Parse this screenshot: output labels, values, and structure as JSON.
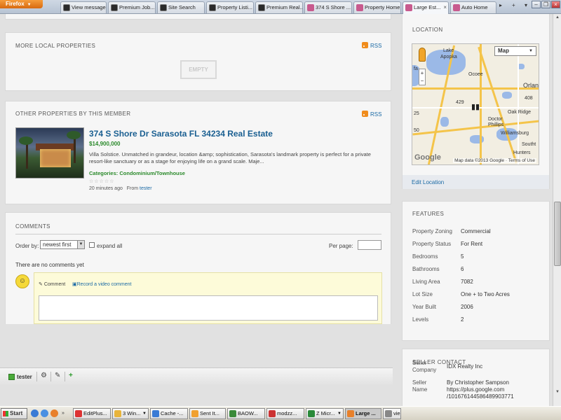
{
  "browser": {
    "firefox_button": "Firefox",
    "tabs": [
      {
        "label": "View message",
        "fav": "dark"
      },
      {
        "label": "Premium Job...",
        "fav": "dark"
      },
      {
        "label": "Site Search",
        "fav": "dark"
      },
      {
        "label": "Property Listi...",
        "fav": "dark"
      },
      {
        "label": "Premium Real...",
        "fav": "dark"
      },
      {
        "label": "374 S Shore ...",
        "fav": "pink"
      },
      {
        "label": "Property Home",
        "fav": "pink"
      },
      {
        "label": "Large Est...",
        "fav": "pink",
        "active": true
      },
      {
        "label": "Auto Home",
        "fav": "pink"
      }
    ]
  },
  "more_local": {
    "title": "MORE LOCAL PROPERTIES",
    "rss": "RSS",
    "empty_label": "EMPTY"
  },
  "other_props": {
    "title": "OTHER PROPERTIES BY THIS MEMBER",
    "rss": "RSS",
    "listing": {
      "title": "374 S Shore Dr Sarasota FL 34234 Real Estate",
      "price": "$14,900,000",
      "description": "Villa Solstice. Unmatched in grandeur, location &amp; sophistication, Sarasota's landmark property is perfect for a private resort-like sanctuary or as a stage for enjoying life on a grand scale. Maje...",
      "categories_label": "Categories:",
      "category": "Condominium/Townhouse",
      "stars": "☆☆☆☆☆",
      "posted": "20 minutes ago",
      "from_label": "From",
      "author": "tester"
    }
  },
  "comments": {
    "title": "COMMENTS",
    "order_by_label": "Order by:",
    "order_by_value": "newest first",
    "expand_all_label": "expand all",
    "per_page_label": "Per page:",
    "no_comments": "There are no comments yet",
    "comment_tab": "Comment",
    "video_tab": "Record a video comment"
  },
  "location": {
    "title": "LOCATION",
    "map_type": "Map",
    "labels": {
      "lake": "Lake",
      "apopka": "Apopka",
      "ocoee": "Ocoee",
      "orlando": "Orlan",
      "oak_ridge": "Oak Ridge",
      "doctor": "Doctor",
      "phillips": "Phillips",
      "williamsburg": "Williamsburg",
      "south": "Southt",
      "hunters": "Hunters",
      "route_a": "25",
      "route_b": "50",
      "route_c": "429",
      "route_d": "408",
      "route_e": "fa"
    },
    "attribution": "Map data ©2013 Google · Terms of Use",
    "google": "Google",
    "edit_label": "Edit Location"
  },
  "features": {
    "title": "FEATURES",
    "rows": [
      {
        "k": "Property Zoning",
        "v": "Commercial"
      },
      {
        "k": "Property Status",
        "v": "For Rent"
      },
      {
        "k": "Bedrooms",
        "v": "5"
      },
      {
        "k": "Bathrooms",
        "v": "6"
      },
      {
        "k": "Living Area",
        "v": "7082"
      },
      {
        "k": "Lot Size",
        "v": "One + to Two Acres"
      },
      {
        "k": "Year Built",
        "v": "2006"
      },
      {
        "k": "Levels",
        "v": "2"
      }
    ]
  },
  "seller": {
    "title": "SELLER CONTACT",
    "company_k1": "Seller",
    "company_k2": "Company",
    "company_v": "IDX Realty Inc",
    "name_k1": "Seller",
    "name_k2": "Name",
    "name_v1": "By Christopher Sampson",
    "name_v2": "https://plus.google.com",
    "name_v3": "/101676144586489903771"
  },
  "user_bar": {
    "user": "tester"
  },
  "taskbar": {
    "start": "Start",
    "items": [
      {
        "label": "EditPlus...",
        "color": "#d33"
      },
      {
        "label": "3 Win...",
        "color": "#e8b43a"
      },
      {
        "label": "Cache -...",
        "color": "#3a7bd5"
      },
      {
        "label": "Sent It...",
        "color": "#f0a030"
      },
      {
        "label": "BAOW...",
        "color": "#3a8a3a"
      },
      {
        "label": "modzz...",
        "color": "#c33"
      },
      {
        "label": "Z Micr...",
        "color": "#2a8a3a"
      },
      {
        "label": "Large ...",
        "color": "#e8802a",
        "active": true
      },
      {
        "label": "vie",
        "color": "#888"
      }
    ]
  }
}
